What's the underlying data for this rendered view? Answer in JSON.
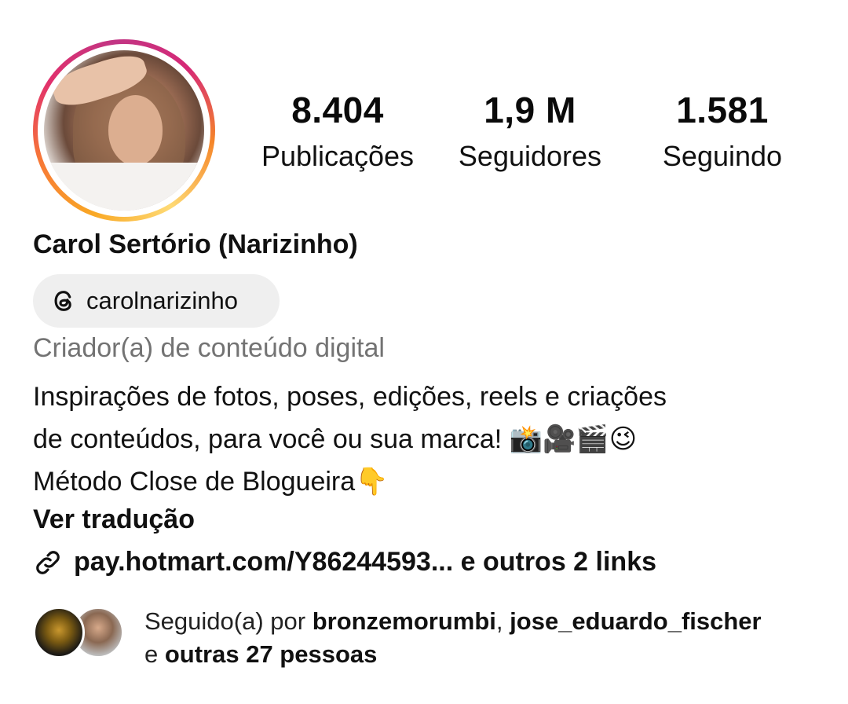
{
  "profile": {
    "stats": [
      {
        "value": "8.404",
        "label": "Publicações"
      },
      {
        "value": "1,9 M",
        "label": "Seguidores"
      },
      {
        "value": "1.581",
        "label": "Seguindo"
      }
    ],
    "name": "Carol Sertório (Narizinho)",
    "threads_handle": "carolnarizinho",
    "category": "Criador(a) de conteúdo digital",
    "bio": {
      "line1": "Inspirações de fotos, poses, edições, reels e criações",
      "line2_text": "de conteúdos, para você ou sua marca! ",
      "line2_emoji": "📸🎥🎬😉",
      "line3_text": "Método Close de Blogueira",
      "line3_emoji": "👇"
    },
    "translate_label": "Ver tradução",
    "link_text": "pay.hotmart.com/Y86244593... e outros 2 links",
    "followed_by": {
      "prefix": "Seguido(a) por ",
      "user1": "bronzemorumbi",
      "sep": ", ",
      "user2": "jose_eduardo_fischer",
      "and": "e ",
      "others": "outras 27 pessoas"
    }
  },
  "colors": {
    "ring_gradient": [
      "#feda75",
      "#f58529",
      "#dd2a7b",
      "#8134af"
    ],
    "chip_bg": "#efefef",
    "muted_text": "#737373"
  },
  "icons": {
    "threads": "threads-icon",
    "link": "link-icon"
  }
}
